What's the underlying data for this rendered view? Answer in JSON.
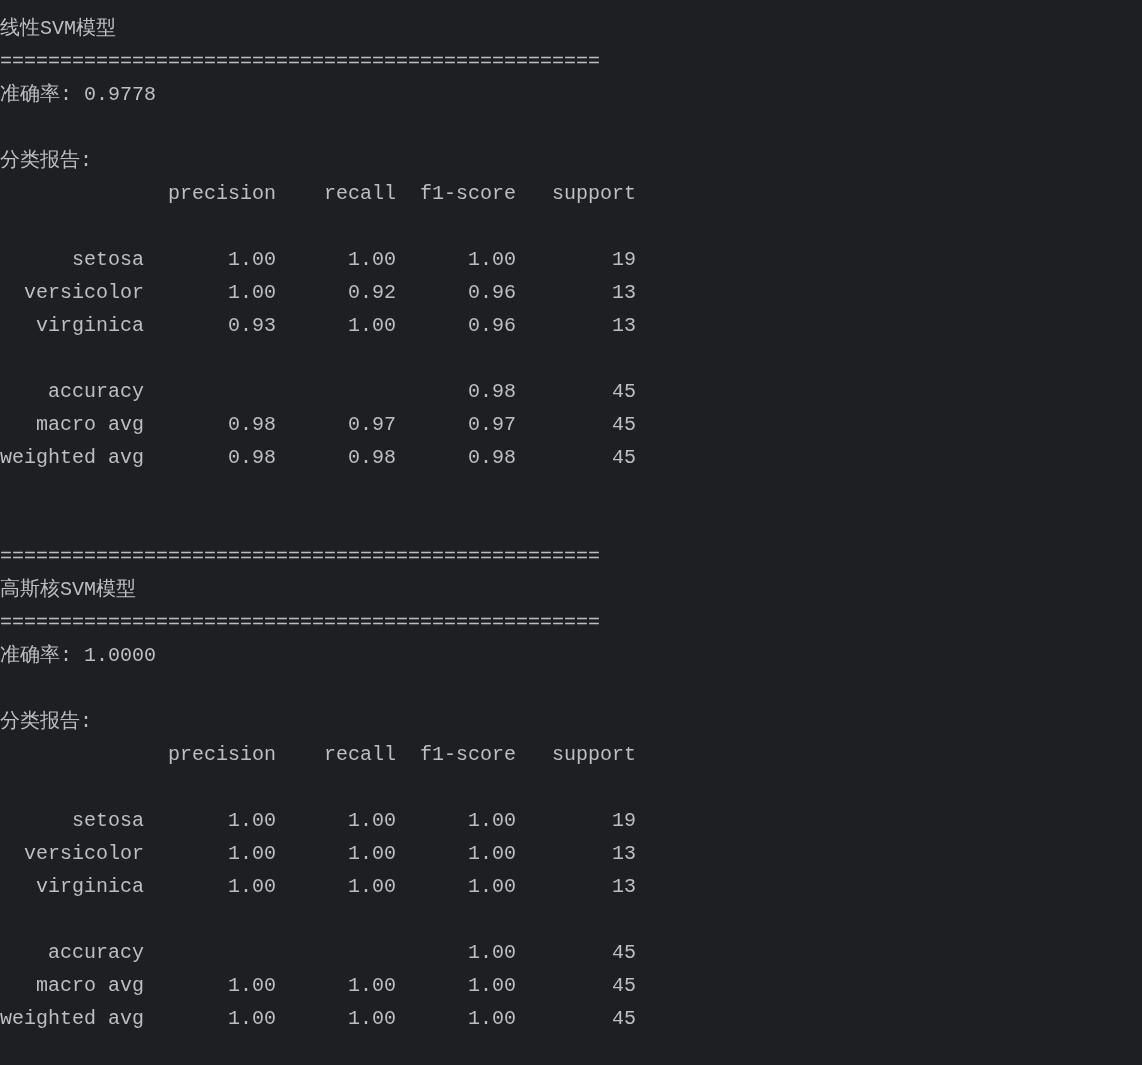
{
  "blocks": [
    {
      "kind": "title",
      "text": "线性SVM模型"
    },
    {
      "kind": "rule",
      "text": "=================================================="
    },
    {
      "kind": "accuracy",
      "text": "准确率: 0.9778"
    },
    {
      "kind": "report_heading",
      "text": "分类报告:"
    },
    {
      "kind": "report",
      "columns": [
        "precision",
        "recall",
        "f1-score",
        "support"
      ],
      "groups": [
        [
          {
            "label": "setosa",
            "precision": "1.00",
            "recall": "1.00",
            "f1_score": "1.00",
            "support": "19"
          },
          {
            "label": "versicolor",
            "precision": "1.00",
            "recall": "0.92",
            "f1_score": "0.96",
            "support": "13"
          },
          {
            "label": "virginica",
            "precision": "0.93",
            "recall": "1.00",
            "f1_score": "0.96",
            "support": "13"
          }
        ],
        [
          {
            "label": "accuracy",
            "f1_score": "0.98",
            "support": "45"
          },
          {
            "label": "macro avg",
            "precision": "0.98",
            "recall": "0.97",
            "f1_score": "0.97",
            "support": "45"
          },
          {
            "label": "weighted avg",
            "precision": "0.98",
            "recall": "0.98",
            "f1_score": "0.98",
            "support": "45"
          }
        ]
      ]
    },
    {
      "kind": "rule",
      "text": "=================================================="
    },
    {
      "kind": "title",
      "text": "高斯核SVM模型"
    },
    {
      "kind": "rule",
      "text": "=================================================="
    },
    {
      "kind": "accuracy",
      "text": "准确率: 1.0000"
    },
    {
      "kind": "report_heading",
      "text": "分类报告:"
    },
    {
      "kind": "report",
      "columns": [
        "precision",
        "recall",
        "f1-score",
        "support"
      ],
      "groups": [
        [
          {
            "label": "setosa",
            "precision": "1.00",
            "recall": "1.00",
            "f1_score": "1.00",
            "support": "19"
          },
          {
            "label": "versicolor",
            "precision": "1.00",
            "recall": "1.00",
            "f1_score": "1.00",
            "support": "13"
          },
          {
            "label": "virginica",
            "precision": "1.00",
            "recall": "1.00",
            "f1_score": "1.00",
            "support": "13"
          }
        ],
        [
          {
            "label": "accuracy",
            "f1_score": "1.00",
            "support": "45"
          },
          {
            "label": "macro avg",
            "precision": "1.00",
            "recall": "1.00",
            "f1_score": "1.00",
            "support": "45"
          },
          {
            "label": "weighted avg",
            "precision": "1.00",
            "recall": "1.00",
            "f1_score": "1.00",
            "support": "45"
          }
        ]
      ]
    }
  ]
}
